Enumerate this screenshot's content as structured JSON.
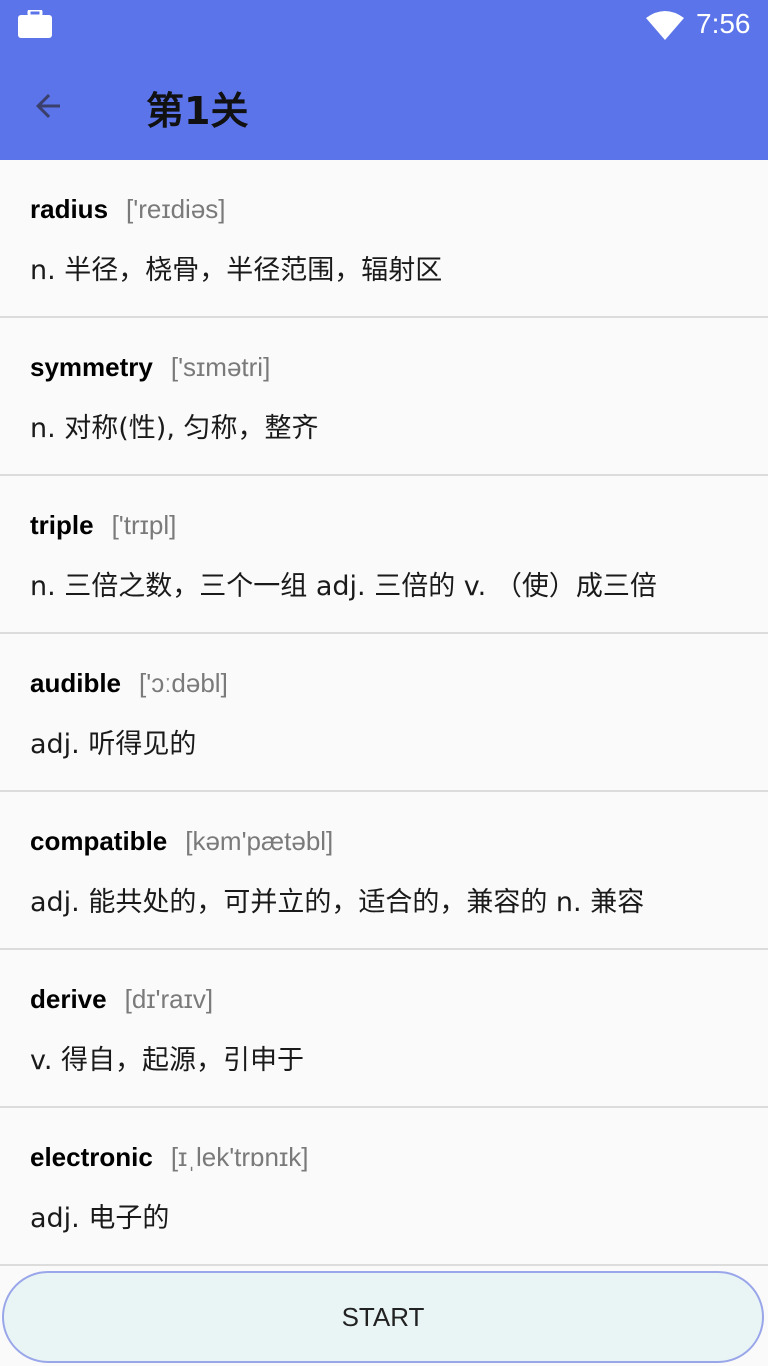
{
  "status_bar": {
    "time": "7:56",
    "icons": [
      "briefcase-icon",
      "wifi-icon"
    ]
  },
  "app_bar": {
    "title": "第1关",
    "back_icon": "arrow-back-icon"
  },
  "words": [
    {
      "word": "radius",
      "phonetic": "['reɪdiəs]",
      "meaning": "n. 半径，桡骨，半径范围，辐射区"
    },
    {
      "word": "symmetry",
      "phonetic": "['sɪmətri]",
      "meaning": "n. 对称(性), 匀称，整齐"
    },
    {
      "word": "triple",
      "phonetic": "['trɪpl]",
      "meaning": "n. 三倍之数，三个一组 adj. 三倍的 v. （使）成三倍"
    },
    {
      "word": "audible",
      "phonetic": "['ɔːdəbl]",
      "meaning": "adj. 听得见的"
    },
    {
      "word": "compatible",
      "phonetic": "[kəm'pætəbl]",
      "meaning": "adj. 能共处的，可并立的，适合的，兼容的 n. 兼容"
    },
    {
      "word": "derive",
      "phonetic": "[dɪ'raɪv]",
      "meaning": "v. 得自，起源，引申于"
    },
    {
      "word": "electronic",
      "phonetic": "[ɪˌlek'trɒnɪk]",
      "meaning": "adj. 电子的"
    }
  ],
  "start_button": {
    "label": "START"
  },
  "colors": {
    "primary": "#5c74ea",
    "background": "#fafafa",
    "button_bg": "#e9f5f5"
  }
}
